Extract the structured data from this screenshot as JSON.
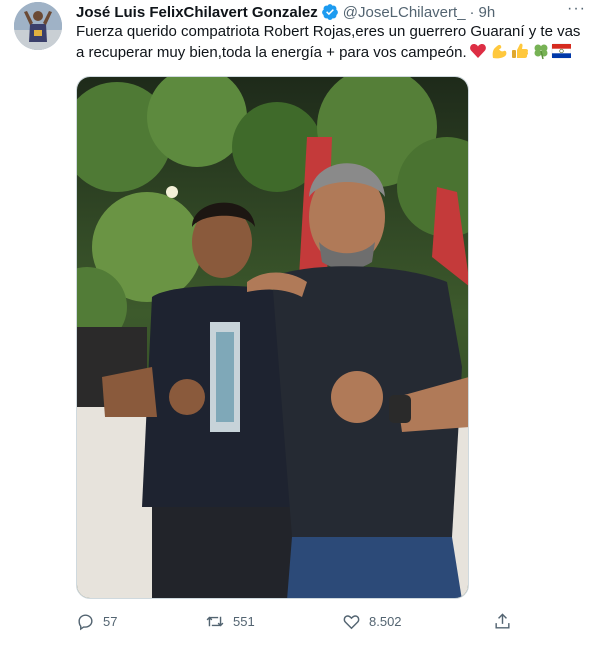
{
  "tweet": {
    "author_name": "José Luis FelixChilavert Gonzalez",
    "handle": "@JoseLChilavert_",
    "separator": "·",
    "time": "9h",
    "more_glyph": "···",
    "text_line_1": "Fuerza querido compatriota Robert Rojas,eres un guerrero Guaraní y te vas",
    "text_line_2": "a recuperar muy bien,toda la energía + para vos campeón.",
    "emojis": [
      "red-heart-icon",
      "flexed-biceps-icon",
      "thumbs-up-icon",
      "four-leaf-clover-icon",
      "paraguay-flag-icon"
    ]
  },
  "actions": {
    "reply_count": "57",
    "retweet_count": "551",
    "like_count": "8.502"
  },
  "colors": {
    "text": "#0f1419",
    "secondary": "#536471",
    "verified": "#1d9bf0",
    "border": "#cfd9de"
  }
}
